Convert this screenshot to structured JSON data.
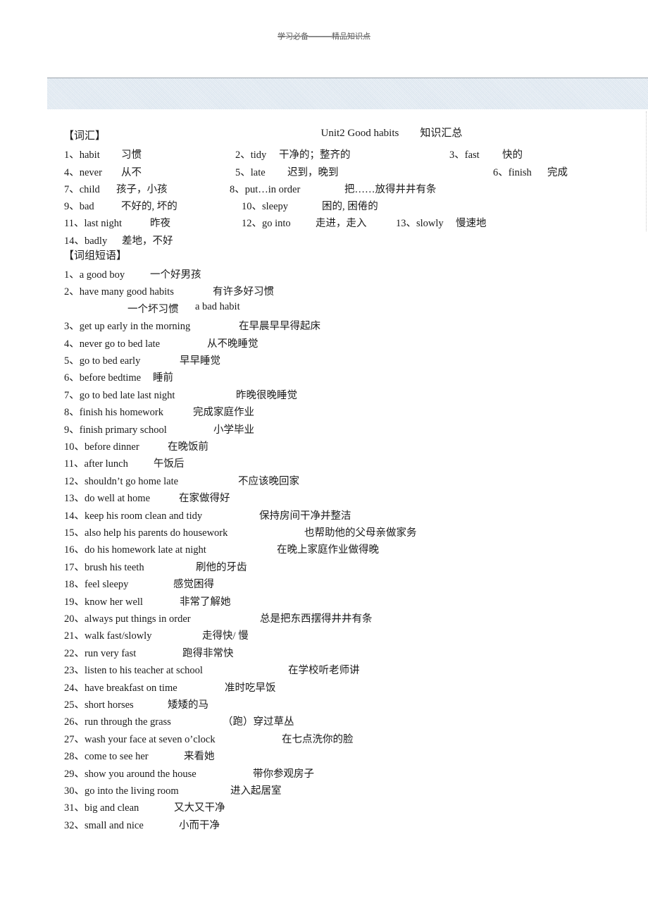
{
  "header": {
    "watermark": "学习必备———精品知识点",
    "title_en": "Unit2 Good habits",
    "title_cn": "知识汇总"
  },
  "vocabulary": {
    "heading": "【词汇】",
    "rows": [
      [
        {
          "num": "1、",
          "en": "habit",
          "cn": "习惯"
        },
        {
          "num": "2、",
          "en": "tidy",
          "cn": "干净的；整齐的"
        },
        {
          "num": "3、",
          "en": "fast",
          "cn": "快的"
        }
      ],
      [
        {
          "num": "4、",
          "en": "never",
          "cn": "从不"
        },
        {
          "num": "5、",
          "en": "late",
          "cn": "迟到，晚到"
        },
        {
          "num": "6、",
          "en": "finish",
          "cn": "完成"
        }
      ],
      [
        {
          "num": "7、",
          "en": "child",
          "cn": "孩子，小孩"
        },
        {
          "num": "8、",
          "en": "put…in order",
          "cn": "把……放得井井有条"
        }
      ],
      [
        {
          "num": "9、",
          "en": "bad",
          "cn": "不好的, 坏的"
        },
        {
          "num": "10、",
          "en": "sleepy",
          "cn": "困的, 困倦的"
        }
      ],
      [
        {
          "num": "11、",
          "en": "last night",
          "cn": "昨夜"
        },
        {
          "num": "12、",
          "en": "go into",
          "cn": "走进，走入"
        },
        {
          "num": "13、",
          "en": "slowly",
          "cn": "慢速地"
        }
      ],
      [
        {
          "num": "14、",
          "en": "badly",
          "cn": "差地，不好"
        }
      ]
    ]
  },
  "phrases": {
    "heading": "【词组短语】",
    "items": [
      {
        "num": "1、",
        "en": "a good boy",
        "cn": "一个好男孩"
      },
      {
        "num": "2、",
        "en": "have many good habits",
        "cn": "有许多好习惯"
      },
      {
        "num": "",
        "en": "a bad habit",
        "cn": "一个坏习惯",
        "reversed": true
      },
      {
        "num": "3、",
        "en": "get up early in the morning",
        "cn": "在早晨早早得起床"
      },
      {
        "num": "4、",
        "en": "never go to bed late",
        "cn": "从不晚睡觉"
      },
      {
        "num": "5、",
        "en": "go to bed early",
        "cn": "早早睡觉"
      },
      {
        "num": "6、",
        "en": "before bedtime",
        "cn": "睡前"
      },
      {
        "num": "7、",
        "en": "go to bed late last night",
        "cn": "昨晚很晚睡觉"
      },
      {
        "num": "8、",
        "en": "finish his homework",
        "cn": "完成家庭作业"
      },
      {
        "num": "9、",
        "en": "finish primary school",
        "cn": "小学毕业"
      },
      {
        "num": "10、",
        "en": "before dinner",
        "cn": "在晚饭前"
      },
      {
        "num": "11、",
        "en": "after lunch",
        "cn": "午饭后"
      },
      {
        "num": "12、",
        "en": "shouldn’t go home late",
        "cn": "不应该晚回家"
      },
      {
        "num": "13、",
        "en": "do well at home",
        "cn": "在家做得好"
      },
      {
        "num": "14、",
        "en": "keep his room clean and tidy",
        "cn": "保持房间干净并整洁"
      },
      {
        "num": "15、",
        "en": "also help his parents do housework",
        "cn": "也帮助他的父母亲做家务"
      },
      {
        "num": "16、",
        "en": "do his homework late at night",
        "cn": "在晚上家庭作业做得晚"
      },
      {
        "num": "17、",
        "en": "brush his teeth",
        "cn": "刷他的牙齿"
      },
      {
        "num": "18、",
        "en": "feel sleepy",
        "cn": "感觉困得"
      },
      {
        "num": "19、",
        "en": "know her well",
        "cn": "非常了解她"
      },
      {
        "num": "20、",
        "en": "always put things in order",
        "cn": "总是把东西摆得井井有条"
      },
      {
        "num": "21、",
        "en": "walk fast/slowly",
        "cn": "走得快/ 慢"
      },
      {
        "num": "22、",
        "en": "run very fast",
        "cn": "跑得非常快"
      },
      {
        "num": "23、",
        "en": "listen to his teacher at school",
        "cn": "在学校听老师讲"
      },
      {
        "num": "24、",
        "en": "have breakfast on time",
        "cn": "准时吃早饭"
      },
      {
        "num": "25、",
        "en": "short horses",
        "cn": "矮矮的马"
      },
      {
        "num": "26、",
        "en": "run through the grass",
        "cn": "（跑）穿过草丛"
      },
      {
        "num": "27、",
        "en": "wash your face at seven o’clock",
        "cn": "在七点洗你的脸"
      },
      {
        "num": "28、",
        "en": "come to see her",
        "cn": "来看她"
      },
      {
        "num": "29、",
        "en": "show you around the house",
        "cn": "带你参观房子"
      },
      {
        "num": "30、",
        "en": "go into the living room",
        "cn": "进入起居室"
      },
      {
        "num": "31、",
        "en": "big and clean",
        "cn": "又大又干净"
      },
      {
        "num": "32、",
        "en": "small and nice",
        "cn": "小而干净"
      }
    ]
  }
}
